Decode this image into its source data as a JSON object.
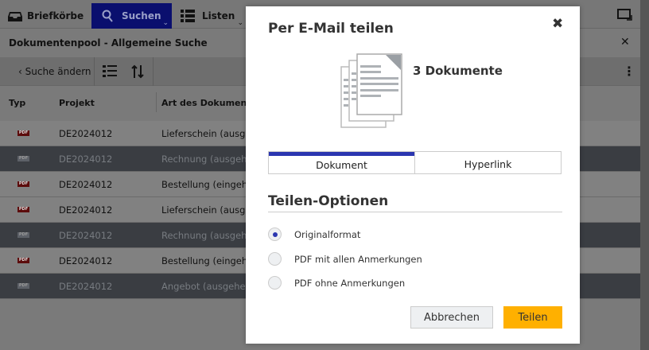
{
  "nav": {
    "items": [
      {
        "label": "Briefkörbe",
        "icon": "inbox-icon"
      },
      {
        "label": "Suchen",
        "icon": "search-icon",
        "active": true
      },
      {
        "label": "Listen",
        "icon": "list-icon"
      }
    ]
  },
  "titlebar": {
    "title": "Dokumentenpool - Allgemeine Suche"
  },
  "toolbar": {
    "back_label": "Suche ändern"
  },
  "table": {
    "columns": [
      "Typ",
      "Projekt",
      "Art des Dokuments"
    ],
    "rows": [
      {
        "type": "PDF",
        "project": "DE2024012",
        "doc": "Lieferschein (ausgeh",
        "selected": false
      },
      {
        "type": "PDF",
        "project": "DE2024012",
        "doc": "Rechnung (ausgehe",
        "selected": true
      },
      {
        "type": "PDF",
        "project": "DE2024012",
        "doc": "Bestellung (eingehe",
        "selected": false
      },
      {
        "type": "PDF",
        "project": "DE2024012",
        "doc": "Lieferschein (ausgeh",
        "selected": false
      },
      {
        "type": "PDF",
        "project": "DE2024012",
        "doc": "Rechnung (ausgehe",
        "selected": true
      },
      {
        "type": "PDF",
        "project": "DE2024012",
        "doc": "Bestellung (eingehe",
        "selected": false
      },
      {
        "type": "PDF",
        "project": "DE2024012",
        "doc": "Angebot (ausgehend",
        "selected": true
      }
    ]
  },
  "modal": {
    "title": "Per E-Mail teilen",
    "doc_count": "3 Dokumente",
    "tabs": [
      {
        "label": "Dokument",
        "active": true
      },
      {
        "label": "Hyperlink",
        "active": false
      }
    ],
    "section": "Teilen-Optionen",
    "options": [
      {
        "label": "Originalformat",
        "checked": true
      },
      {
        "label": "PDF mit allen Anmerkungen",
        "checked": false
      },
      {
        "label": "PDF ohne Anmerkungen",
        "checked": false
      }
    ],
    "cancel": "Abbrechen",
    "submit": "Teilen"
  },
  "colors": {
    "accent": "#2b36b0",
    "primary_button": "#ffb000"
  }
}
